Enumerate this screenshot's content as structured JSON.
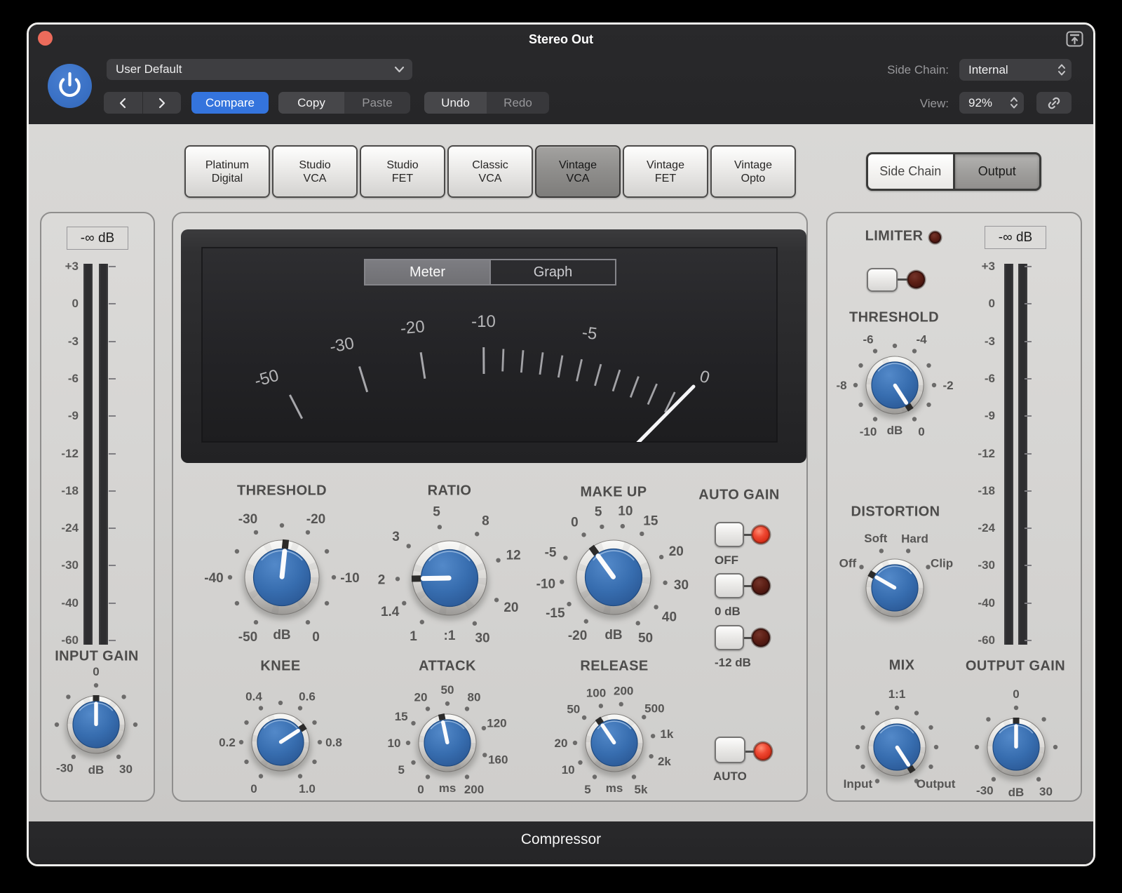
{
  "window": {
    "title": "Stereo Out",
    "footer": "Compressor"
  },
  "header": {
    "close_icon": "close-dot",
    "power_icon": "power-symbol",
    "preset": {
      "value": "User Default",
      "icon": "chevron-down-icon"
    },
    "nav": {
      "prev_icon": "chevron-left",
      "next_icon": "chevron-right"
    },
    "compare_label": "Compare",
    "copy_paste": [
      {
        "label": "Copy",
        "active": true
      },
      {
        "label": "Paste",
        "active": false
      }
    ],
    "undo_redo": [
      {
        "label": "Undo",
        "active": true
      },
      {
        "label": "Redo",
        "active": false
      }
    ],
    "side_chain": {
      "label": "Side Chain:",
      "value": "Internal"
    },
    "view": {
      "label": "View:",
      "value": "92%"
    },
    "popout_icon": "open-in-window",
    "link_icon": "chain-link"
  },
  "models": [
    {
      "label": "Platinum\nDigital",
      "selected": false
    },
    {
      "label": "Studio\nVCA",
      "selected": false
    },
    {
      "label": "Studio\nFET",
      "selected": false
    },
    {
      "label": "Classic\nVCA",
      "selected": false
    },
    {
      "label": "Vintage\nVCA",
      "selected": true
    },
    {
      "label": "Vintage\nFET",
      "selected": false
    },
    {
      "label": "Vintage\nOpto",
      "selected": false
    }
  ],
  "output_toggle": [
    {
      "label": "Side Chain",
      "selected": false
    },
    {
      "label": "Output",
      "selected": true
    }
  ],
  "gauge": {
    "tabs": [
      {
        "label": "Meter",
        "selected": true
      },
      {
        "label": "Graph",
        "selected": false
      }
    ],
    "scale_labels": [
      {
        "text": "-50",
        "angle": -29.0
      },
      {
        "text": "-30",
        "angle": -18.6
      },
      {
        "text": "-20",
        "angle": -9.4
      },
      {
        "text": "-10",
        "angle": -0.4
      },
      {
        "text": "-5",
        "angle": 13.1
      },
      {
        "text": "0",
        "angle": 28.7
      }
    ],
    "major_ticks": [
      -27.2,
      -17.2,
      -8.8,
      -0.4
    ],
    "minor_ticks": [
      2.24,
      4.88,
      7.52,
      10.16,
      12.8,
      15.44,
      18.08,
      20.72,
      23.36,
      26.0
    ],
    "needle_angle": 27.0
  },
  "meters": {
    "left": {
      "value": "-∞ dB",
      "scale": [
        "+3",
        "0",
        "-3",
        "-6",
        "-9",
        "-12",
        "-18",
        "-24",
        "-30",
        "-40",
        "-60"
      ]
    },
    "right": {
      "value": "-∞ dB",
      "scale": [
        "+3",
        "0",
        "-3",
        "-6",
        "-9",
        "-12",
        "-18",
        "-24",
        "-30",
        "-40",
        "-60"
      ]
    }
  },
  "section_titles": [
    {
      "id": "threshold",
      "text": "THRESHOLD"
    },
    {
      "id": "ratio",
      "text": "RATIO"
    },
    {
      "id": "makeup",
      "text": "MAKE UP"
    },
    {
      "id": "autogain",
      "text": "AUTO GAIN"
    },
    {
      "id": "knee",
      "text": "KNEE"
    },
    {
      "id": "attack",
      "text": "ATTACK"
    },
    {
      "id": "release",
      "text": "RELEASE"
    },
    {
      "id": "limiter",
      "text": "LIMITER"
    },
    {
      "id": "limiter_threshold",
      "text": "THRESHOLD"
    },
    {
      "id": "distortion",
      "text": "DISTORTION"
    },
    {
      "id": "mix",
      "text": "MIX"
    },
    {
      "id": "output_gain",
      "text": "OUTPUT GAIN"
    },
    {
      "id": "input_gain",
      "text": "INPUT GAIN"
    }
  ],
  "knobs": [
    {
      "id": "threshold",
      "size": "large",
      "pointer_angle": 6,
      "labels": [
        [
          "-50",
          -150
        ],
        [
          "-40",
          -90
        ],
        [
          "-30",
          -30
        ],
        [
          "-20",
          30
        ],
        [
          "-10",
          90
        ],
        [
          "0",
          150
        ]
      ],
      "dots": [
        -150,
        -120,
        -90,
        -60,
        -30,
        0,
        30,
        60,
        90,
        120,
        150
      ],
      "unit": "dB"
    },
    {
      "id": "ratio",
      "size": "large",
      "pointer_angle": -91,
      "labels": [
        [
          "1",
          -148
        ],
        [
          "1.4",
          -119
        ],
        [
          "2",
          -91
        ],
        [
          "3",
          -52
        ],
        [
          "5",
          -11
        ],
        [
          "8",
          32
        ],
        [
          "12",
          70
        ],
        [
          "20",
          115
        ],
        [
          "30",
          151
        ]
      ],
      "dots": [
        -148,
        -119,
        -91,
        -52,
        -11,
        32,
        70,
        115,
        151
      ],
      "unit": ":1"
    },
    {
      "id": "makeup",
      "size": "large",
      "pointer_angle": -36,
      "labels": [
        [
          "-20",
          -148
        ],
        [
          "-15",
          -121
        ],
        [
          "-10",
          -95
        ],
        [
          "-5",
          -68
        ],
        [
          "0",
          -35
        ],
        [
          "5",
          -13
        ],
        [
          "10",
          10
        ],
        [
          "15",
          33
        ],
        [
          "20",
          67
        ],
        [
          "30",
          96
        ],
        [
          "40",
          125
        ],
        [
          "50",
          152
        ]
      ],
      "dots": [
        -148,
        -121,
        -95,
        -68,
        -35,
        -13,
        10,
        33,
        67,
        96,
        125,
        152
      ],
      "unit": "dB"
    },
    {
      "id": "knee",
      "size": "small",
      "pointer_angle": 57,
      "labels": [
        [
          "0",
          -150
        ],
        [
          "0.2",
          -90
        ],
        [
          "0.4",
          -30
        ],
        [
          "0.6",
          30
        ],
        [
          "0.8",
          90
        ],
        [
          "1.0",
          150
        ]
      ],
      "dots": [
        -150,
        -120,
        -90,
        -60,
        -30,
        0,
        30,
        60,
        90,
        120,
        150
      ],
      "unit": ""
    },
    {
      "id": "attack",
      "size": "small",
      "pointer_angle": -12,
      "labels": [
        [
          "0",
          -150
        ],
        [
          "5",
          -120
        ],
        [
          "10",
          -90
        ],
        [
          "15",
          -60
        ],
        [
          "20",
          -30
        ],
        [
          "50",
          0
        ],
        [
          "80",
          30
        ],
        [
          "120",
          68
        ],
        [
          "160",
          108
        ],
        [
          "200",
          150
        ]
      ],
      "dots": [
        -150,
        -120,
        -90,
        -60,
        -30,
        0,
        30,
        68,
        108,
        150
      ],
      "unit": "ms"
    },
    {
      "id": "release",
      "size": "small",
      "pointer_angle": -34,
      "labels": [
        [
          "5",
          -150
        ],
        [
          "10",
          -120
        ],
        [
          "20",
          -90
        ],
        [
          "50",
          -50
        ],
        [
          "100",
          -20
        ],
        [
          "200",
          10
        ],
        [
          "500",
          49
        ],
        [
          "1k",
          80
        ],
        [
          "2k",
          110
        ],
        [
          "5k",
          150
        ]
      ],
      "dots": [
        -150,
        -120,
        -90,
        -50,
        -20,
        10,
        49,
        80,
        110,
        150
      ],
      "unit": "ms"
    },
    {
      "id": "limiter_threshold",
      "size": "small",
      "pointer_angle": 147,
      "labels": [
        [
          "-10",
          -150
        ],
        [
          "-8",
          -90
        ],
        [
          "-6",
          -30
        ],
        [
          "-4",
          30
        ],
        [
          "-2",
          90
        ],
        [
          "0",
          150
        ]
      ],
      "dots": [
        -150,
        -120,
        -90,
        -60,
        -30,
        0,
        30,
        60,
        90,
        120,
        150
      ],
      "unit": "dB"
    },
    {
      "id": "distortion",
      "size": "small",
      "pointer_angle": -60,
      "labels": [
        [
          "Off",
          -62
        ],
        [
          "Soft",
          -21
        ],
        [
          "Hard",
          22
        ],
        [
          "Clip",
          62
        ]
      ],
      "dots": [
        -58,
        -20,
        20,
        58
      ],
      "unit": ""
    },
    {
      "id": "mix",
      "size": "small",
      "pointer_angle": 147,
      "labels": [
        [
          "1:1",
          0
        ],
        [
          "Input",
          -133
        ],
        [
          "Output",
          133
        ]
      ],
      "dots": [
        -150,
        -120,
        -90,
        -60,
        -30,
        0,
        30,
        60,
        90,
        120,
        150
      ],
      "unit": ""
    },
    {
      "id": "output_gain",
      "size": "small",
      "pointer_angle": 0,
      "labels": [
        [
          "-30",
          -144
        ],
        [
          "0",
          0
        ],
        [
          "30",
          146
        ]
      ],
      "dots": [
        -145,
        -90,
        -45,
        0,
        45,
        90,
        145
      ],
      "unit": "dB"
    },
    {
      "id": "input_gain",
      "size": "small",
      "pointer_angle": 0,
      "labels": [
        [
          "-30",
          -144
        ],
        [
          "0",
          0
        ],
        [
          "30",
          146
        ]
      ],
      "dots": [
        -145,
        -90,
        -45,
        0,
        45,
        90,
        145
      ],
      "unit": "dB"
    }
  ],
  "auto_gain": {
    "buttons": [
      {
        "label": "OFF",
        "led_on": true
      },
      {
        "label": "0 dB",
        "led_on": false
      },
      {
        "label": "-12 dB",
        "led_on": false
      }
    ],
    "auto_button": {
      "label": "AUTO",
      "led_on": true
    }
  },
  "limiter": {
    "indicator_led_on": false,
    "button_led_on": false
  },
  "colors": {
    "accent_blue": "#3474dd",
    "knob_blue": "#3a70b5",
    "led_red": "#e8473a",
    "header_bg": "#272729",
    "panel_bg": "#d5d4d2"
  }
}
